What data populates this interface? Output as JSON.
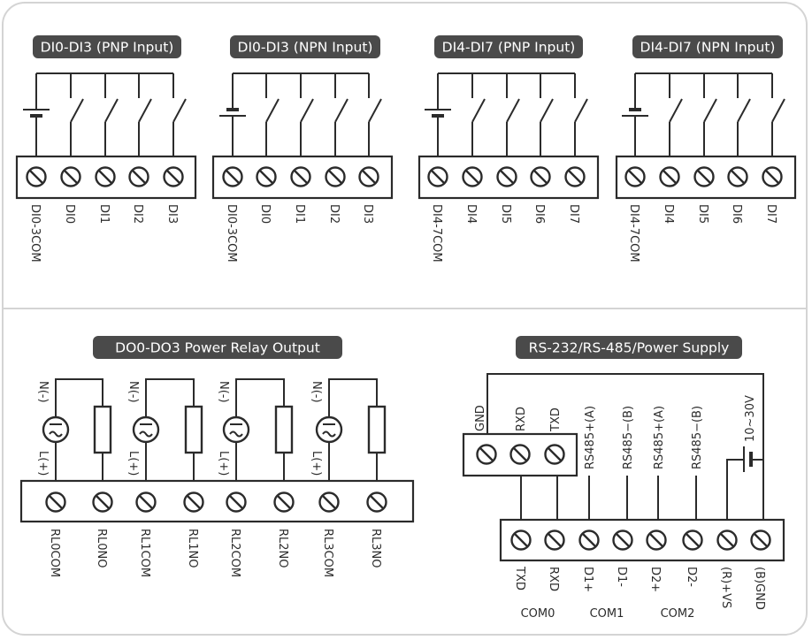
{
  "colors": {
    "title_bg": "#4a4a4a",
    "title_fg": "#ffffff",
    "line": "#2b2b2b",
    "frame": "#d4d4d4"
  },
  "input_blocks": [
    {
      "title": "DI0-DI3 (PNP Input)",
      "type": "PNP",
      "terminals": [
        "DI0-3COM",
        "DI0",
        "DI1",
        "DI2",
        "DI3"
      ]
    },
    {
      "title": "DI0-DI3 (NPN Input)",
      "type": "NPN",
      "terminals": [
        "DI0-3COM",
        "DI0",
        "DI1",
        "DI2",
        "DI3"
      ]
    },
    {
      "title": "DI4-DI7 (PNP Input)",
      "type": "PNP",
      "terminals": [
        "DI4-7COM",
        "DI4",
        "DI5",
        "DI6",
        "DI7"
      ]
    },
    {
      "title": "DI4-DI7 (NPN Input)",
      "type": "NPN",
      "terminals": [
        "DI4-7COM",
        "DI4",
        "DI5",
        "DI6",
        "DI7"
      ]
    }
  ],
  "relay_block": {
    "title": "DO0-DO3 Power Relay Output",
    "load_labels": {
      "neutral": "N(-)",
      "live": "L(+)"
    },
    "terminals": [
      "RL0COM",
      "RL0NO",
      "RL1COM",
      "RL1NO",
      "RL2COM",
      "RL2NO",
      "RL3COM",
      "RL3NO"
    ]
  },
  "comm_block": {
    "title": "RS-232/RS-485/Power Supply",
    "connector_labels": [
      "GND",
      "RXD",
      "TXD"
    ],
    "wire_labels": [
      "RS485+(A)",
      "RS485−(B)",
      "RS485+(A)",
      "RS485−(B)"
    ],
    "supply_label": "10~30V",
    "terminals": [
      "TXD",
      "RXD",
      "D1+",
      "D1-",
      "D2+",
      "D2-",
      "(R)+VS",
      "(B)GND"
    ],
    "groups": [
      "COM0",
      "COM1",
      "COM2"
    ]
  }
}
